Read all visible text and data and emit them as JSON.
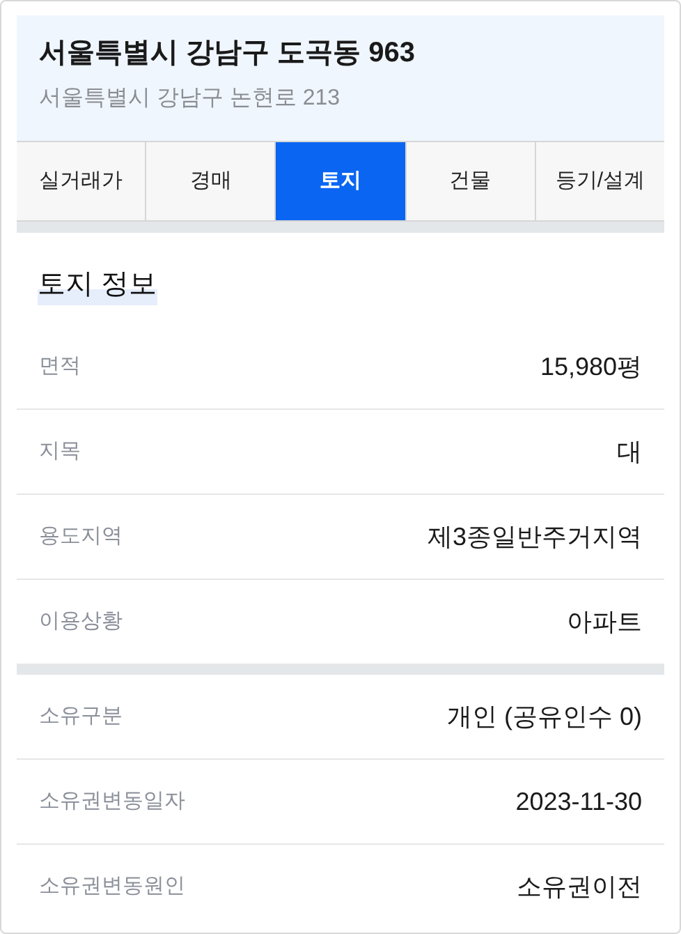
{
  "header": {
    "title": "서울특별시 강남구 도곡동 963",
    "address": "서울특별시 강남구 논현로 213"
  },
  "tabs": [
    {
      "label": "실거래가",
      "selected": false
    },
    {
      "label": "경매",
      "selected": false
    },
    {
      "label": "토지",
      "selected": true
    },
    {
      "label": "건물",
      "selected": false
    },
    {
      "label": "등기/설계",
      "selected": false
    }
  ],
  "section_title": "토지 정보",
  "groups": [
    [
      {
        "label": "면적",
        "value": "15,980평"
      },
      {
        "label": "지목",
        "value": "대"
      },
      {
        "label": "용도지역",
        "value": "제3종일반주거지역"
      },
      {
        "label": "이용상황",
        "value": "아파트"
      }
    ],
    [
      {
        "label": "소유구분",
        "value": "개인 (공유인수 0)"
      },
      {
        "label": "소유권변동일자",
        "value": "2023-11-30"
      },
      {
        "label": "소유권변동원인",
        "value": "소유권이전"
      }
    ]
  ]
}
